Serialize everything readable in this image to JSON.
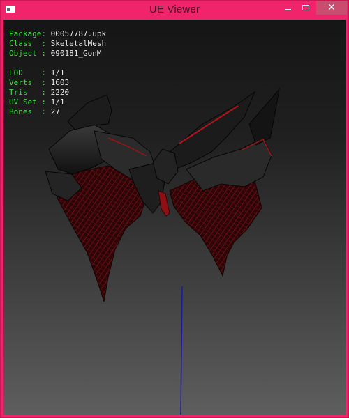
{
  "window": {
    "title": "UE Viewer",
    "controls": {
      "minimize": "",
      "maximize": "",
      "close": "✕"
    },
    "colors": {
      "frame": "#f0246a",
      "close_bg": "#c84d6e",
      "info_label": "#4cd74c",
      "info_value": "#e8e8e8",
      "axis_line": "#1a1aa0"
    }
  },
  "info": {
    "package": {
      "label": "Package:",
      "value": "00057787.upk"
    },
    "class": {
      "label": "Class  :",
      "value": "SkeletalMesh"
    },
    "object": {
      "label": "Object :",
      "value": "090181_GonM"
    },
    "lod": {
      "label": "LOD    :",
      "value": "1/1"
    },
    "verts": {
      "label": "Verts  :",
      "value": "1603"
    },
    "tris": {
      "label": "Tris   :",
      "value": "2220"
    },
    "uvset": {
      "label": "UV Set :",
      "value": "1/1"
    },
    "bones": {
      "label": "Bones  :",
      "value": "27"
    }
  },
  "viewport": {
    "icons": {
      "app": "app-window-icon",
      "minimize": "minimize-icon",
      "maximize": "maximize-icon",
      "close": "close-icon"
    }
  }
}
